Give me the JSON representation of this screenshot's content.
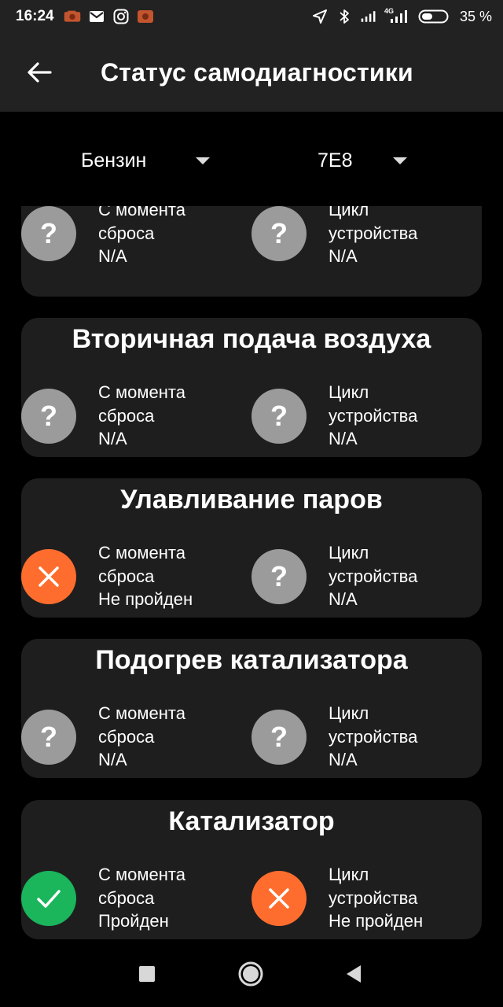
{
  "status_bar": {
    "time": "16:24",
    "battery_percent": "35 %",
    "network_label": "4G",
    "left_icons": [
      "notification-app-icon",
      "mail-icon",
      "instagram-icon",
      "notification-app-icon-2"
    ],
    "right_icons": [
      "location-icon",
      "bluetooth-icon",
      "signal-icon",
      "signal-4g-icon",
      "battery-icon"
    ]
  },
  "app_bar": {
    "title": "Статус самодиагностики",
    "back_icon": "back-arrow-icon"
  },
  "selectors": {
    "fuel": "Бензин",
    "ecu": "7E8"
  },
  "cards": [
    {
      "title": "",
      "left": {
        "label": "С момента сброса",
        "value": "N/A",
        "status": "unknown"
      },
      "right": {
        "label": "Цикл устройства",
        "value": "N/A",
        "status": "unknown"
      }
    },
    {
      "title": "Вторичная подача воздуха",
      "left": {
        "label": "С момента сброса",
        "value": "N/A",
        "status": "unknown"
      },
      "right": {
        "label": "Цикл устройства",
        "value": "N/A",
        "status": "unknown"
      }
    },
    {
      "title": "Улавливание паров",
      "left": {
        "label": "С момента сброса",
        "value": "Не пройден",
        "status": "fail"
      },
      "right": {
        "label": "Цикл устройства",
        "value": "N/A",
        "status": "unknown"
      }
    },
    {
      "title": "Подогрев катализатора",
      "left": {
        "label": "С момента сброса",
        "value": "N/A",
        "status": "unknown"
      },
      "right": {
        "label": "Цикл устройства",
        "value": "N/A",
        "status": "unknown"
      }
    },
    {
      "title": "Катализатор",
      "left": {
        "label": "С момента сброса",
        "value": "Пройден",
        "status": "pass"
      },
      "right": {
        "label": "Цикл устройства",
        "value": "Не пройден",
        "status": "fail"
      }
    }
  ],
  "status_colors": {
    "unknown": "#9b9b9b",
    "fail": "#ff6d2e",
    "pass": "#1bb55c"
  },
  "nav_bar": {
    "icons": [
      "recents-square-icon",
      "home-circle-icon",
      "back-triangle-icon"
    ]
  }
}
